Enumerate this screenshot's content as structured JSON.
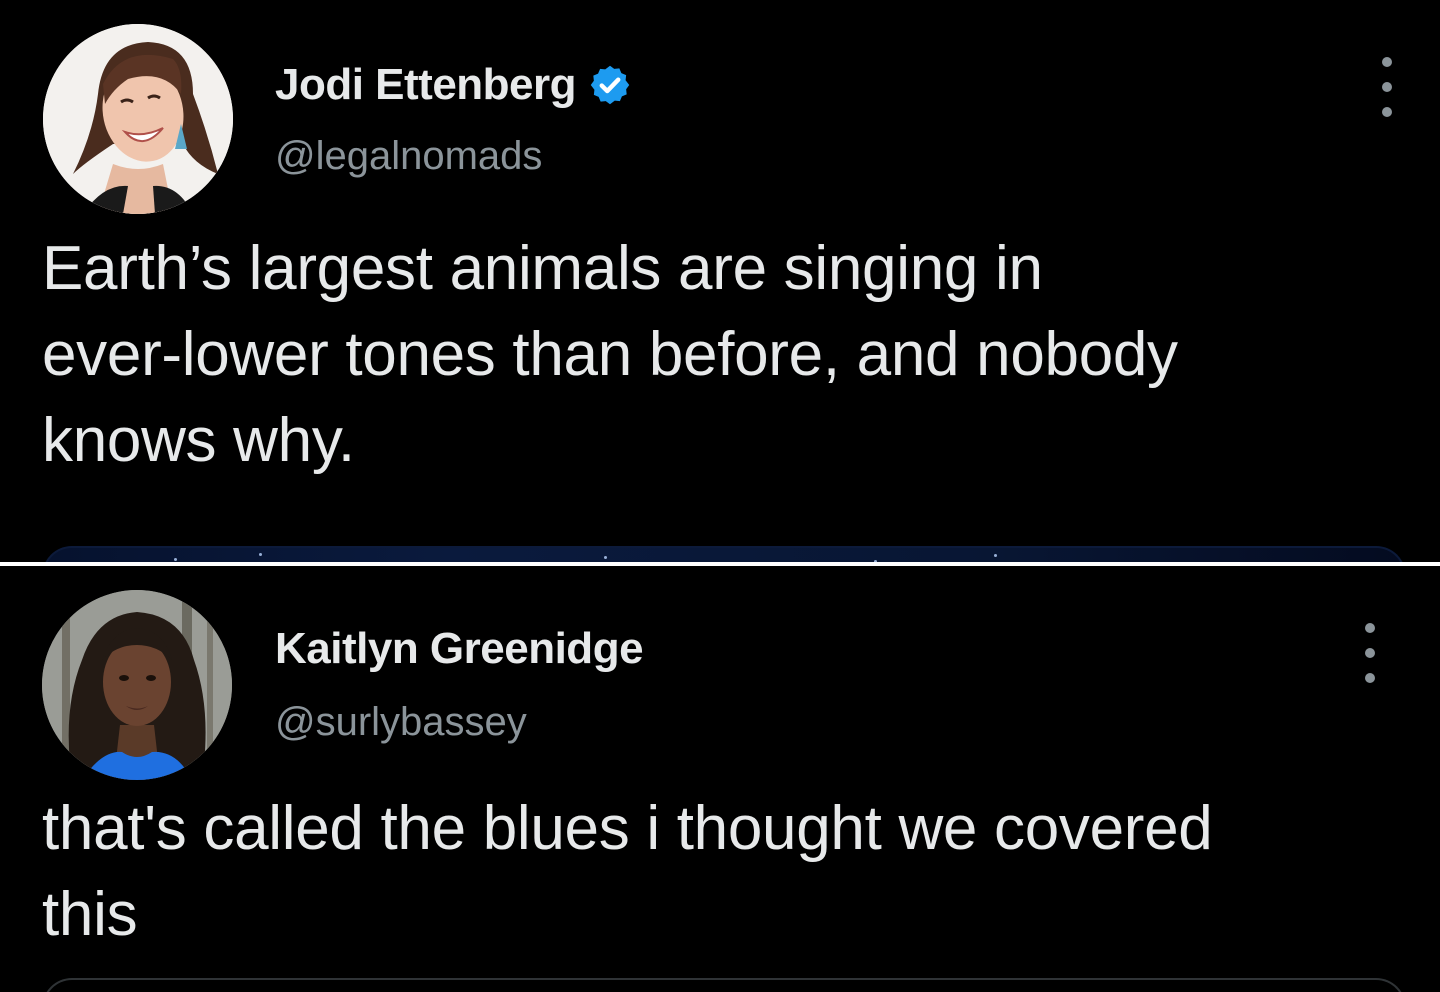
{
  "tweets": [
    {
      "display_name": "Jodi Ettenberg",
      "verified": true,
      "handle": "@legalnomads",
      "text_lines": [
        "Earth’s largest animals are singing in",
        "ever-lower tones than before, and nobody",
        "knows why."
      ]
    },
    {
      "display_name": "Kaitlyn Greenidge",
      "verified": false,
      "handle": "@surlybassey",
      "text_lines": [
        "that's called the blues i thought we covered",
        "this"
      ]
    }
  ],
  "colors": {
    "background": "#000000",
    "text": "#e7e9ea",
    "secondary_text": "#8b949a",
    "verified_badge": "#1d9bf0",
    "divider": "#ffffff"
  },
  "icons": {
    "verified": "verified-badge-icon",
    "more": "more-options-icon"
  }
}
